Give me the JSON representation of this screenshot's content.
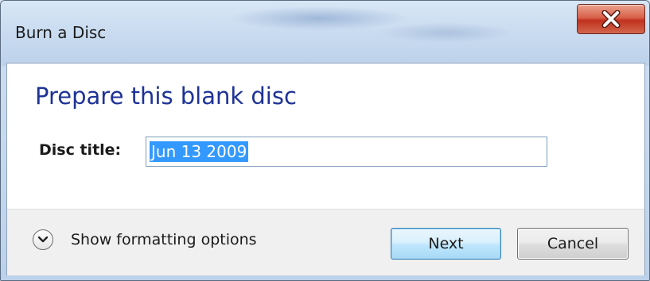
{
  "window": {
    "title": "Burn a Disc",
    "close_glyph": "X"
  },
  "main": {
    "heading": "Prepare this blank disc",
    "disc_title": {
      "label": "Disc title:",
      "value": "Jun 13 2009"
    }
  },
  "footer": {
    "expander_label": "Show formatting options",
    "next_label": "Next",
    "cancel_label": "Cancel"
  },
  "colors": {
    "heading": "#1e3296",
    "selection": "#3399ff",
    "close_button": "#c0321f"
  },
  "icons": {
    "close": "close-icon",
    "expander": "chevron-down-icon"
  }
}
